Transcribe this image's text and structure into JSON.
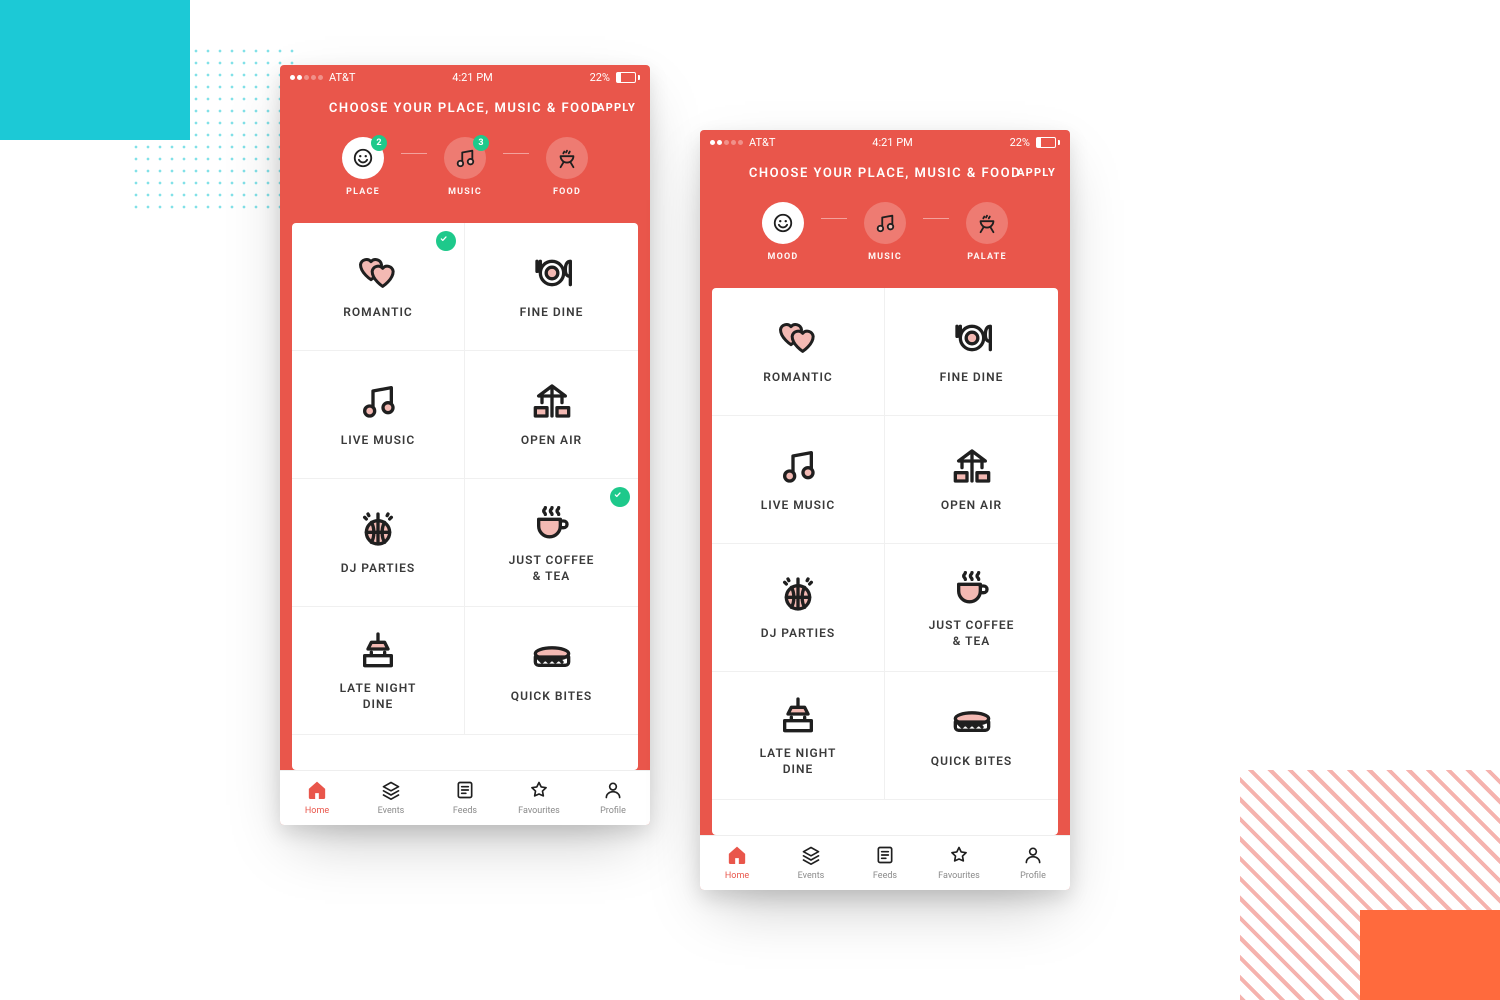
{
  "status": {
    "carrier": "AT&T",
    "time": "4:21 PM",
    "battery": "22%",
    "signal_dots_on": 2,
    "signal_dots_total": 5
  },
  "header": {
    "title": "CHOOSE YOUR PLACE, MUSIC\n& FOOD",
    "apply": "APPLY"
  },
  "screens": {
    "a": {
      "steps": [
        {
          "label": "PLACE",
          "active": true,
          "badge": "2",
          "icon": "smile"
        },
        {
          "label": "MUSIC",
          "active": false,
          "badge": "3",
          "icon": "music"
        },
        {
          "label": "FOOD",
          "active": false,
          "icon": "grill"
        }
      ],
      "tiles": [
        {
          "label": "ROMANTIC",
          "icon": "hearts",
          "selected": true
        },
        {
          "label": "FINE DINE",
          "icon": "finedine",
          "selected": false
        },
        {
          "label": "LIVE MUSIC",
          "icon": "music",
          "selected": false
        },
        {
          "label": "OPEN AIR",
          "icon": "openair",
          "selected": false
        },
        {
          "label": "DJ PARTIES",
          "icon": "disco",
          "selected": false
        },
        {
          "label": "JUST COFFEE\n& TEA",
          "icon": "coffee",
          "selected": true
        },
        {
          "label": "LATE NIGHT\nDINE",
          "icon": "lamp",
          "selected": false
        },
        {
          "label": "QUICK BITES",
          "icon": "sandwich",
          "selected": false
        }
      ]
    },
    "b": {
      "steps": [
        {
          "label": "MOOD",
          "active": true,
          "icon": "smile"
        },
        {
          "label": "MUSIC",
          "active": false,
          "icon": "music"
        },
        {
          "label": "PALATE",
          "active": false,
          "icon": "grill"
        }
      ],
      "tiles": [
        {
          "label": "ROMANTIC",
          "icon": "hearts",
          "selected": false
        },
        {
          "label": "FINE DINE",
          "icon": "finedine",
          "selected": false
        },
        {
          "label": "LIVE MUSIC",
          "icon": "music",
          "selected": false
        },
        {
          "label": "OPEN AIR",
          "icon": "openair",
          "selected": false
        },
        {
          "label": "DJ PARTIES",
          "icon": "disco",
          "selected": false
        },
        {
          "label": "JUST COFFEE\n& TEA",
          "icon": "coffee",
          "selected": false
        },
        {
          "label": "LATE NIGHT\nDINE",
          "icon": "lamp",
          "selected": false
        },
        {
          "label": "QUICK BITES",
          "icon": "sandwich",
          "selected": false
        }
      ]
    }
  },
  "tabs": [
    {
      "label": "Home",
      "icon": "home",
      "active": true
    },
    {
      "label": "Events",
      "icon": "events",
      "active": false
    },
    {
      "label": "Feeds",
      "icon": "feeds",
      "active": false
    },
    {
      "label": "Favourites",
      "icon": "star",
      "active": false
    },
    {
      "label": "Profile",
      "icon": "user",
      "active": false
    }
  ],
  "colors": {
    "primary": "#e9564b",
    "accent": "#1ec98b",
    "teal": "#1cc9d6"
  }
}
